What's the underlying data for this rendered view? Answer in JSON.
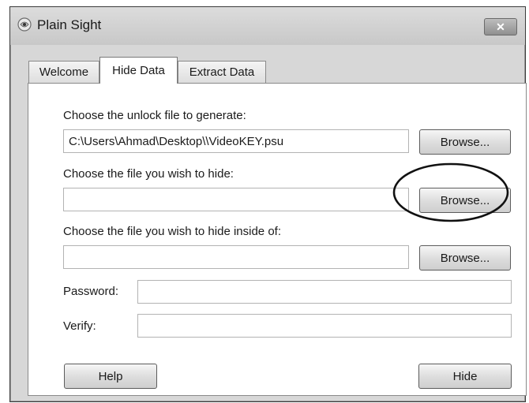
{
  "window": {
    "title": "Plain Sight",
    "close_glyph": "✕"
  },
  "tabs": [
    {
      "label": "Welcome",
      "active": false
    },
    {
      "label": "Hide Data",
      "active": true
    },
    {
      "label": "Extract Data",
      "active": false
    }
  ],
  "form": {
    "unlock_file": {
      "label": "Choose the unlock file to generate:",
      "value": "C:\\Users\\Ahmad\\Desktop\\\\VideoKEY.psu",
      "browse_label": "Browse..."
    },
    "hide_file": {
      "label": "Choose the file you wish to hide:",
      "value": "",
      "browse_label": "Browse..."
    },
    "host_file": {
      "label": "Choose the file you wish to hide inside of:",
      "value": "",
      "browse_label": "Browse..."
    },
    "password": {
      "label": "Password:",
      "value": ""
    },
    "verify": {
      "label": "Verify:",
      "value": ""
    }
  },
  "buttons": {
    "help_label": "Help",
    "hide_label": "Hide"
  },
  "icons": {
    "app": "app-icon",
    "close": "close-icon"
  },
  "annotation": {
    "ellipse_color": "#111111"
  }
}
